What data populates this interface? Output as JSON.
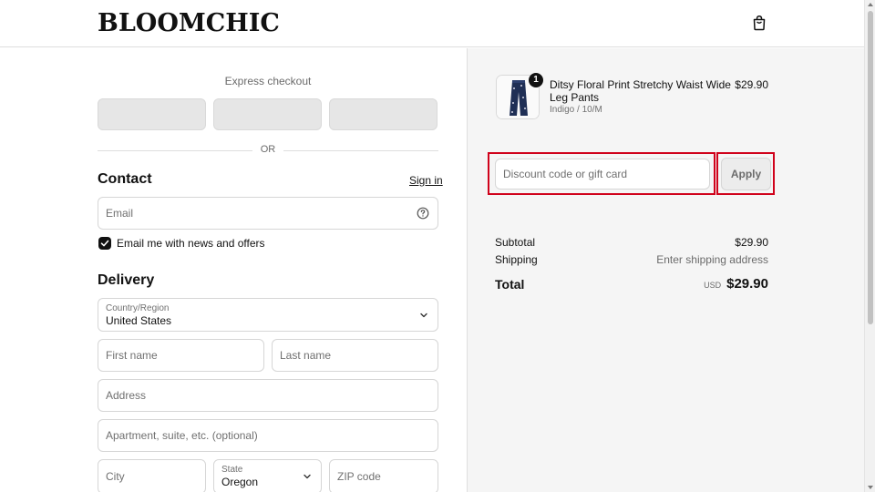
{
  "header": {
    "logo": "BLOOMCHIC",
    "cart_icon": "shopping-bag-icon"
  },
  "express": {
    "label": "Express checkout",
    "or_text": "OR"
  },
  "contact": {
    "title": "Contact",
    "sign_in": "Sign in",
    "email_placeholder": "Email",
    "help_icon": "help-circle-icon",
    "newsletter_label": "Email me with news and offers",
    "newsletter_checked": true
  },
  "delivery": {
    "title": "Delivery",
    "country_label": "Country/Region",
    "country_value": "United States",
    "first_name_placeholder": "First name",
    "last_name_placeholder": "Last name",
    "address_placeholder": "Address",
    "apartment_placeholder": "Apartment, suite, etc. (optional)",
    "city_placeholder": "City",
    "state_label": "State",
    "state_value": "Oregon",
    "zip_placeholder": "ZIP code"
  },
  "order": {
    "item": {
      "name": "Ditsy Floral Print Stretchy Waist Wide Leg Pants",
      "variant": "Indigo / 10/M",
      "price": "$29.90",
      "quantity": "1"
    },
    "discount_placeholder": "Discount code or gift card",
    "apply_label": "Apply",
    "subtotal_label": "Subtotal",
    "subtotal_value": "$29.90",
    "shipping_label": "Shipping",
    "shipping_value": "Enter shipping address",
    "total_label": "Total",
    "total_currency": "USD",
    "total_value": "$29.90"
  },
  "colors": {
    "highlight": "#d0021b",
    "summary_bg": "#f5f5f5"
  }
}
